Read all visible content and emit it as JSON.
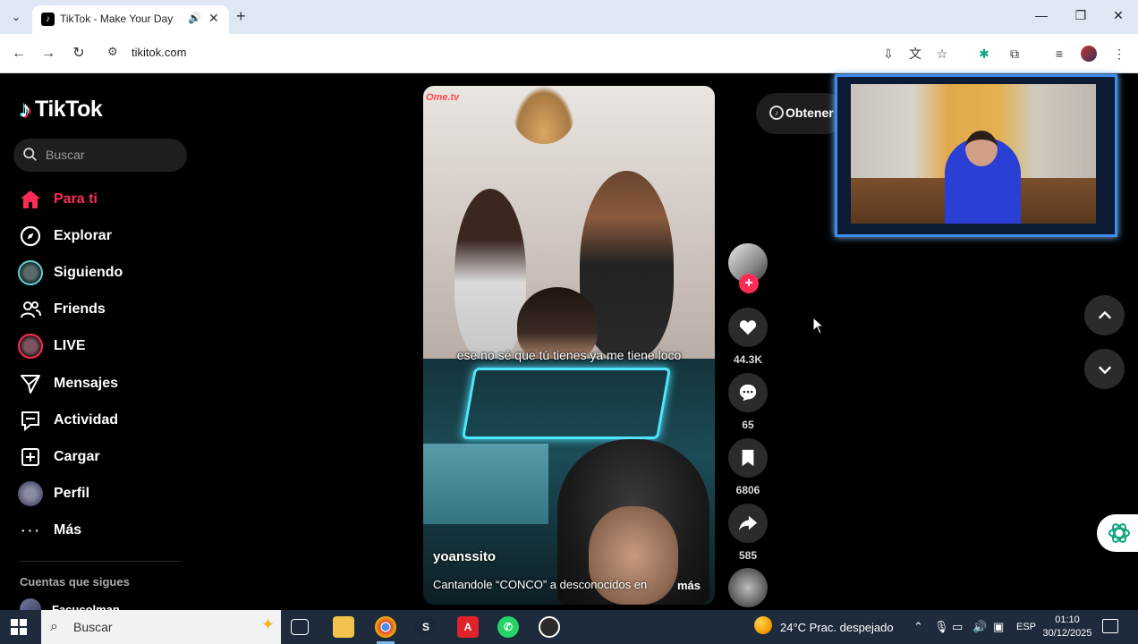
{
  "browser": {
    "tab_title": "TikTok - Make Your Day",
    "url": "tikitok.com"
  },
  "sidebar": {
    "logo_text": "TikTok",
    "search_placeholder": "Buscar",
    "items": [
      {
        "label": "Para ti",
        "icon": "home-icon"
      },
      {
        "label": "Explorar",
        "icon": "compass-icon"
      },
      {
        "label": "Siguiendo",
        "icon": "avatar"
      },
      {
        "label": "Friends",
        "icon": "friends-icon"
      },
      {
        "label": "LIVE",
        "icon": "avatar"
      },
      {
        "label": "Mensajes",
        "icon": "send-icon"
      },
      {
        "label": "Actividad",
        "icon": "message-square-icon"
      },
      {
        "label": "Cargar",
        "icon": "plus-square-icon"
      },
      {
        "label": "Perfil",
        "icon": "avatar"
      },
      {
        "label": "Más",
        "icon": "more-icon"
      }
    ],
    "following_title": "Cuentas que sigues",
    "following": [
      {
        "name": "Facucolman"
      }
    ]
  },
  "video": {
    "watermark": "Ome.tv",
    "caption": "ese no sé que tú tienes ya me tiene loco",
    "author": "yoanssito",
    "description": "Cantandole “CONCO” a desconocidos en",
    "more_label": "más"
  },
  "actions": {
    "likes": "44.3K",
    "comments": "65",
    "saves": "6806",
    "shares": "585"
  },
  "get_app_label": "Obtener",
  "taskbar": {
    "search_label": "Buscar",
    "weather": "24°C  Prac. despejado",
    "language": "ESP",
    "time": "01:10",
    "date": "30/12/2025"
  },
  "colors": {
    "accent": "#fe2c55",
    "tiktok_cyan": "#25f4ee",
    "webcam_border": "#3d8df0",
    "taskbar": "#1d2b3c"
  }
}
